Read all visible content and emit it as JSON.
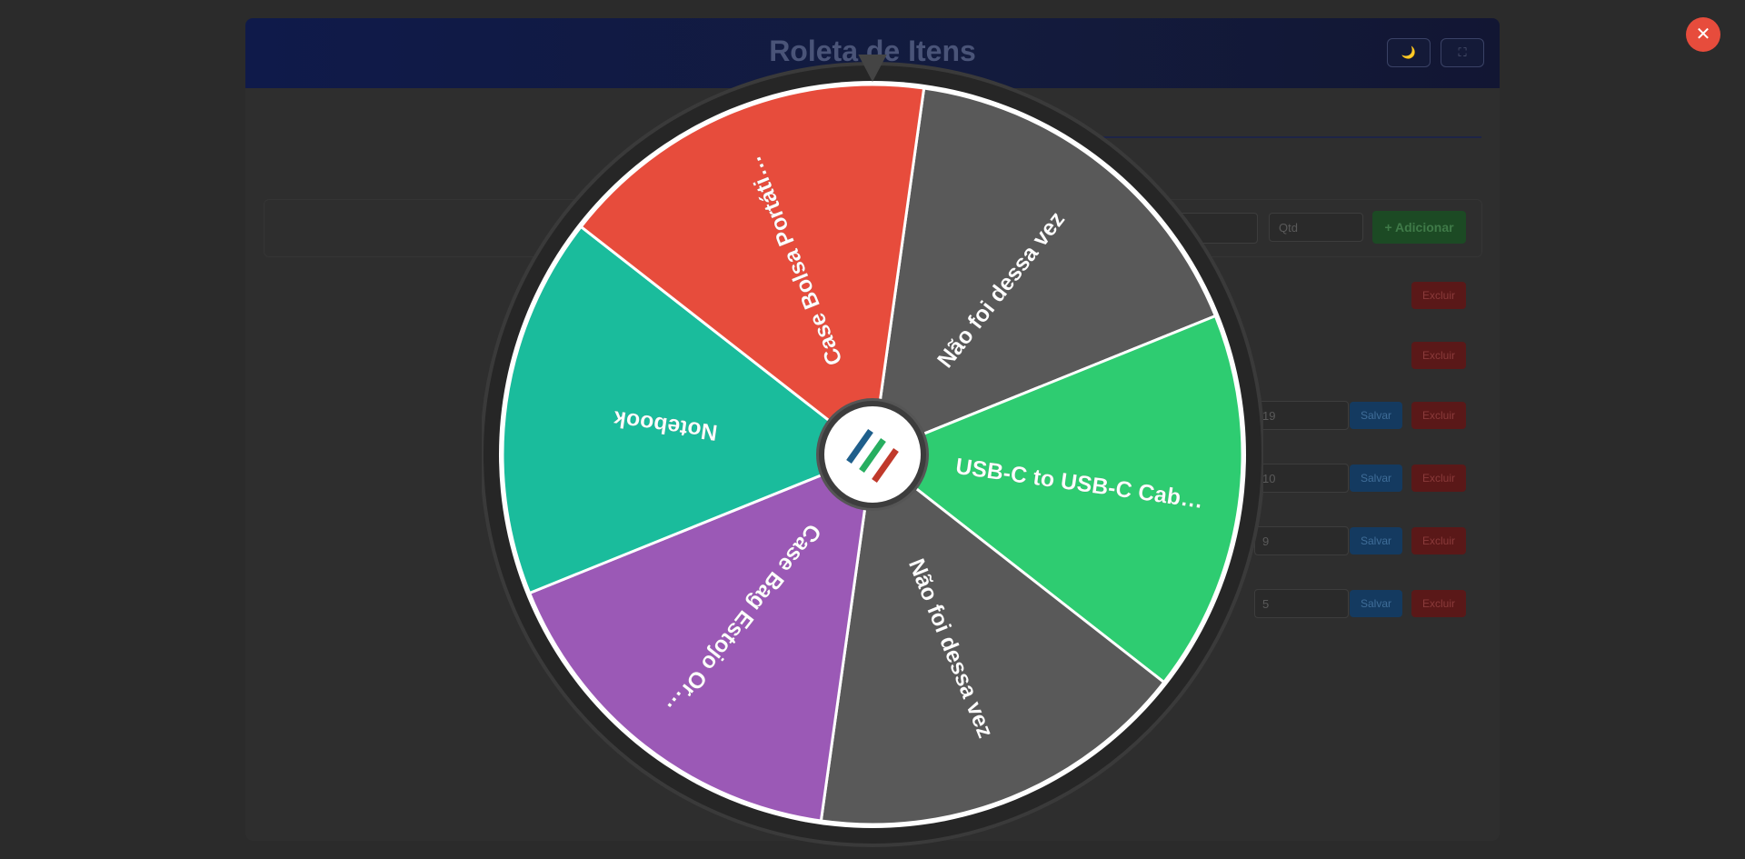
{
  "app": {
    "title": "Roleta de Itens",
    "header_buttons": [
      "🌙",
      "⛶"
    ],
    "form": {
      "qty_placeholder": "Qtd",
      "add_label": "+ Adicionar"
    },
    "rows": [
      {
        "qty": "",
        "save_label": "",
        "delete_label": "Excluir"
      },
      {
        "qty": "",
        "save_label": "",
        "delete_label": "Excluir"
      },
      {
        "qty": "19",
        "save_label": "Salvar",
        "delete_label": "Excluir"
      },
      {
        "qty": "10",
        "save_label": "Salvar",
        "delete_label": "Excluir"
      },
      {
        "qty": "9",
        "save_label": "Salvar",
        "delete_label": "Excluir"
      },
      {
        "qty": "5",
        "save_label": "Salvar",
        "delete_label": "Excluir"
      }
    ]
  },
  "modal": {
    "close_label": "✕",
    "wheel": {
      "segments": [
        {
          "label": "Não foi dessa vez",
          "color": "#595959"
        },
        {
          "label": "USB-C to USB-C Cab…",
          "color": "#2ecc71"
        },
        {
          "label": "Não foi dessa vez",
          "color": "#595959"
        },
        {
          "label": "Case Bag Estojo Or…",
          "color": "#9b59b6"
        },
        {
          "label": "Notebook",
          "color": "#1abc9c"
        },
        {
          "label": "Case Bolsa Portáti…",
          "color": "#e74c3c"
        }
      ],
      "center_logo": "logo-icon",
      "pointer": "pointer-icon"
    }
  },
  "colors": {
    "overlay": "#2b2b2b",
    "close_button": "#e74c3c",
    "logo_stripes": [
      "#1f5f8b",
      "#27ae60",
      "#c0392b"
    ]
  }
}
